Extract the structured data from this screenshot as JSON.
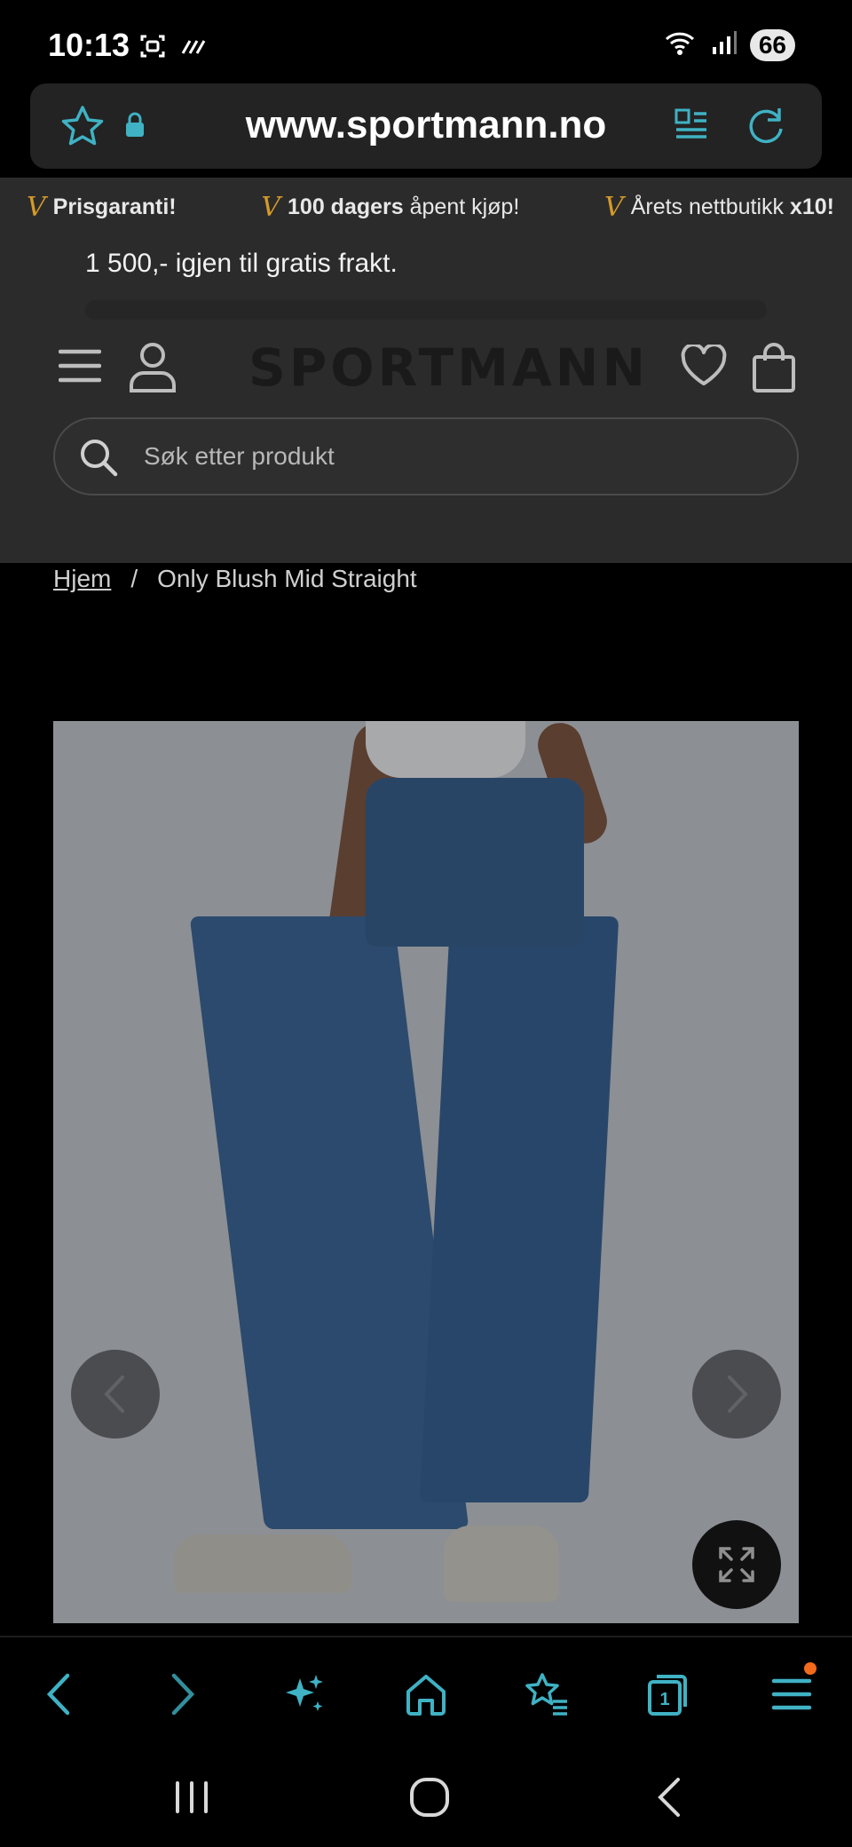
{
  "status_bar": {
    "time": "10:13",
    "battery": "66",
    "icons": [
      "screenshot-icon",
      "nfc-icon",
      "wifi-icon",
      "signal-icon"
    ]
  },
  "browser": {
    "url": "www.sportmann.no",
    "icons": [
      "star-icon",
      "lock-icon",
      "reader-mode-icon",
      "reload-icon"
    ]
  },
  "promo": {
    "items": [
      {
        "check": "V",
        "bold": "Prisgaranti!",
        "rest": ""
      },
      {
        "check": "V",
        "bold": "100 dagers",
        "rest": " åpent kjøp!"
      },
      {
        "check": "V",
        "bold": "",
        "rest": "Årets nettbutikk ",
        "bold_end": "x10!"
      }
    ],
    "free_shipping": "1 500,- igjen til gratis frakt."
  },
  "header": {
    "logo": "SPORTMANN",
    "search_placeholder": "Søk etter produkt"
  },
  "breadcrumb": {
    "home": "Hjem",
    "separator": "/",
    "current": "Only Blush Mid Straight"
  },
  "toolbar": {
    "accent_color": "#3fb2c4",
    "buttons": [
      "back-icon",
      "forward-icon",
      "ai-sparkle-icon",
      "home-icon",
      "bookmarks-icon",
      "tabs-icon",
      "menu-icon"
    ],
    "tabs_count": "1"
  },
  "colors": {
    "accent": "#3fb2c4",
    "promo_check": "#d49a2a",
    "notification": "#f26a1b"
  }
}
